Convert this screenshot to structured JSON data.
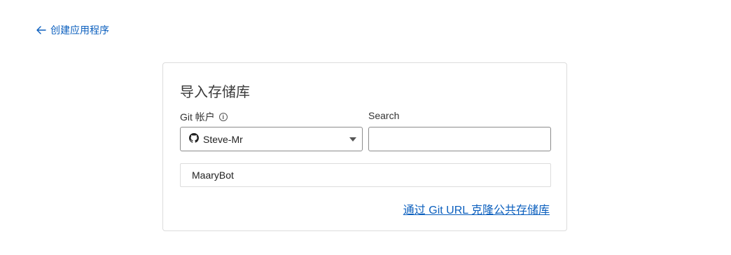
{
  "back_link": {
    "label": "创建应用程序"
  },
  "card": {
    "title": "导入存储库",
    "git_account": {
      "label": "Git 帐户",
      "info_icon": "i",
      "selected_value": "Steve-Mr"
    },
    "search": {
      "label": "Search",
      "value": "",
      "placeholder": ""
    },
    "repositories": [
      {
        "name": "MaaryBot"
      }
    ],
    "clone_link": "通过 Git URL 克隆公共存储库"
  },
  "colors": {
    "link": "#0b5fbe",
    "border": "#dcdcdc",
    "input_border": "#8c8c8c"
  }
}
